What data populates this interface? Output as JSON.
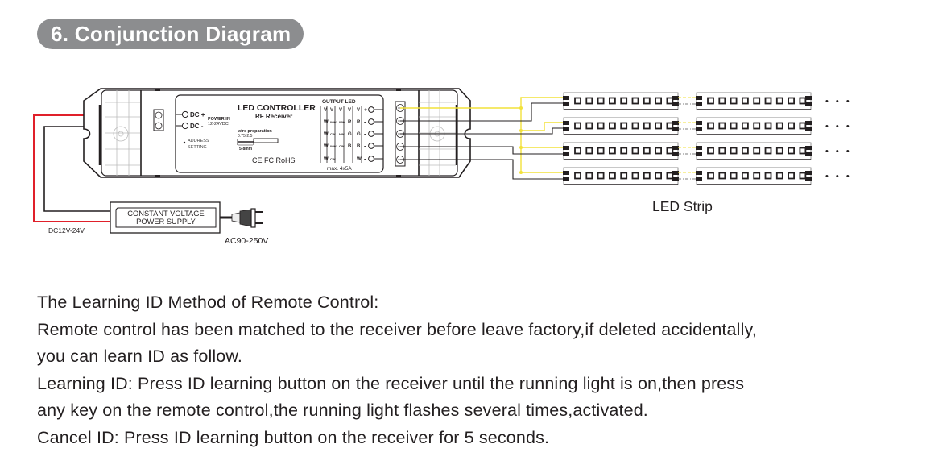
{
  "section": {
    "number": "6.",
    "title": "6. Conjunction Diagram"
  },
  "colors": {
    "pill_background": "#8c8d8f",
    "red_wire": "#e0202a",
    "yellow_wire": "#f2e23a",
    "black_wire": "#231f20",
    "text": "#231f20"
  },
  "controller": {
    "title": "LED CONTROLLER",
    "subtitle": "RF Receiver",
    "input_terminals": [
      {
        "label": "DC +"
      },
      {
        "label": "DC -"
      }
    ],
    "power_in_label": "POWER IN",
    "power_in_range": "12-24VDC",
    "address_label_1": "ADDRESS",
    "address_label_2": "SETTING",
    "wire_prep_label": "wire preparation",
    "wire_prep_size": "0.75-2.5",
    "wire_prep_strip": "5-8mm",
    "certifications": "CE FC RoHS",
    "output_header": "OUTPUT LED",
    "output_table": [
      [
        "V",
        "V",
        "V",
        "V",
        "V"
      ],
      [
        "W",
        "WW",
        "WW",
        "R",
        "R"
      ],
      [
        "W",
        "CW",
        "NW",
        "G",
        "G"
      ],
      [
        "W",
        "WW",
        "CW",
        "B",
        "B"
      ],
      [
        "W",
        "CW",
        "",
        "",
        "W"
      ]
    ],
    "output_terminals": [
      "+",
      "-",
      "-",
      "-",
      "-"
    ],
    "max_rating": "max. 4x5A"
  },
  "power_supply": {
    "line1": "CONSTANT VOLTAGE",
    "line2": "POWER SUPPLY",
    "dc_label": "DC12V-24V",
    "ac_label": "AC90-250V"
  },
  "led_strip": {
    "label": "LED Strip",
    "rows": 4,
    "segments_per_row": 2,
    "leds_per_segment": 9,
    "continuation": "• • •"
  },
  "instructions": {
    "heading": "The Learning ID Method of Remote Control:",
    "line1": "Remote control has been matched to the receiver before leave factory,if deleted accidentally,",
    "line2": "you can learn ID as follow.",
    "line3": "Learning ID: Press ID learning button on the receiver until the running light is on,then press",
    "line4": "any key on the remote control,the running light flashes several times,activated.",
    "line5": "Cancel ID: Press ID learning button on the receiver for 5 seconds."
  }
}
